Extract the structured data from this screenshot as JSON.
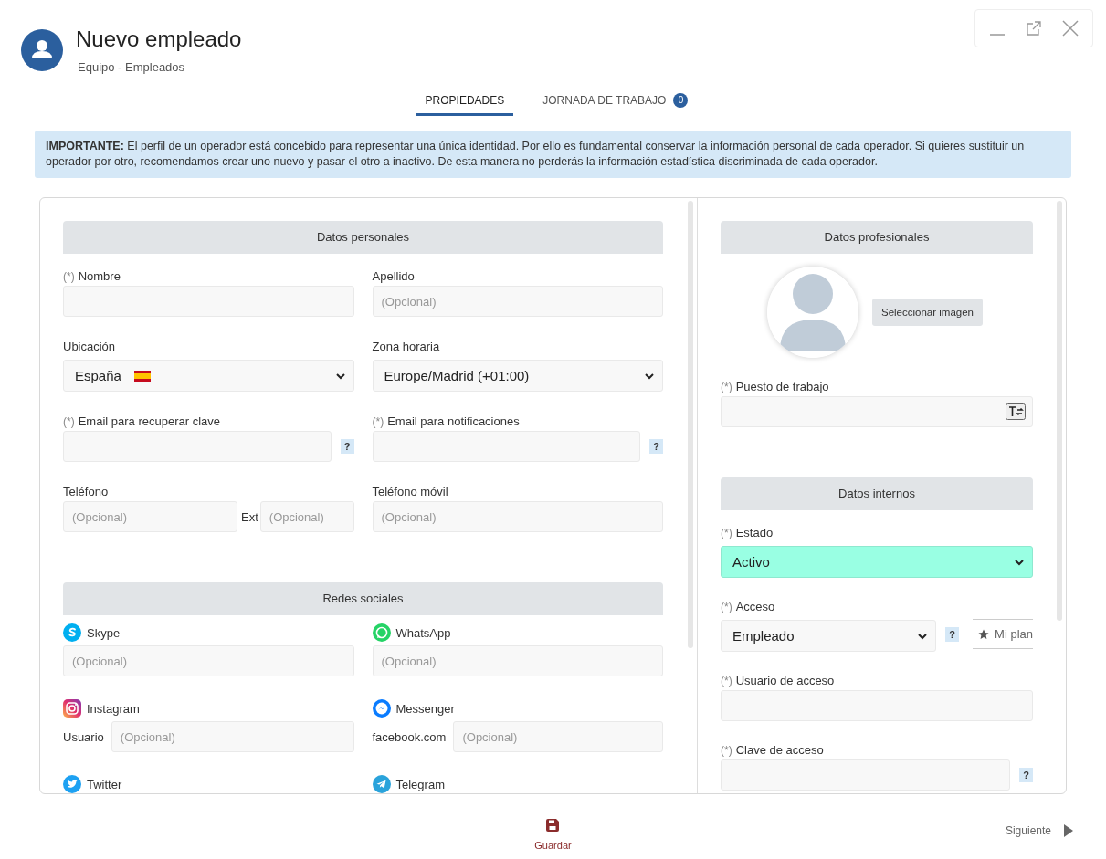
{
  "window": {
    "title": "Nuevo empleado",
    "subtitle": "Equipo - Empleados"
  },
  "tabs": [
    {
      "label": "PROPIEDADES",
      "selected": true
    },
    {
      "label": "JORNADA DE TRABAJO",
      "selected": false,
      "badge": "0"
    }
  ],
  "notice": "**IMPORTANTE:** El perfil de un operador está concebido para representar una única identidad. Por ello es fundamental conservar la información personal de cada operador. Si quieres sustituir un operador por otro, recomendamos crear uno nuevo y pasar el otro a inactivo. De esta manera no perderás la información estadística discriminada de cada operador.",
  "left_sections": [
    {
      "title": "Datos personales",
      "fields": [
        {
          "kind": "text",
          "required_mark": "(*)",
          "label": "Nombre"
        },
        {
          "kind": "text",
          "label": "Apellido",
          "placeholder": "(Opcional)"
        },
        {
          "kind": "country-select",
          "label": "Ubicación",
          "value": "España"
        },
        {
          "kind": "select",
          "label": "Zona horaria",
          "value": "Europe/Madrid (+01:00)"
        },
        {
          "kind": "text",
          "required_mark": "(*)",
          "label": "Email para recuperar clave",
          "help": "?"
        },
        {
          "kind": "text",
          "required_mark": "(*)",
          "label": "Email para notificaciones",
          "help": "?"
        },
        {
          "kind": "phone",
          "label": "Teléfono",
          "placeholder": "(Opcional)",
          "ext_label": "Ext",
          "ext_placeholder": "(Opcional)"
        },
        {
          "kind": "text",
          "label": "Teléfono móvil",
          "placeholder": "(Opcional)"
        }
      ]
    },
    {
      "title": "Redes sociales",
      "fields": [
        {
          "kind": "skype",
          "label": "Skype",
          "placeholder": "(Opcional)"
        },
        {
          "kind": "whatsapp",
          "label": "WhatsApp",
          "placeholder": "(Opcional)"
        },
        {
          "kind": "instagram",
          "label": "Instagram",
          "prefix": "Usuario",
          "placeholder": "(Opcional)"
        },
        {
          "kind": "messenger",
          "label": "Messenger",
          "prefix": "facebook.com",
          "placeholder": "(Opcional)"
        },
        {
          "kind": "twitter",
          "label": "Twitter"
        },
        {
          "kind": "telegram",
          "label": "Telegram"
        }
      ]
    }
  ],
  "right_sections": [
    {
      "title": "Datos profesionales",
      "fields": [
        {
          "kind": "photo",
          "button": "Seleccionar imagen"
        },
        {
          "kind": "text-toggle",
          "required_mark": "(*)",
          "label": "Puesto de trabajo"
        }
      ]
    },
    {
      "title": "Datos internos",
      "fields": [
        {
          "kind": "status-select",
          "required_mark": "(*)",
          "label": "Estado",
          "value": "Activo"
        },
        {
          "kind": "select",
          "required_mark": "(*)",
          "label": "Acceso",
          "value": "Empleado",
          "help": "?",
          "extra_button": "Mi plan"
        },
        {
          "kind": "text",
          "required_mark": "(*)",
          "label": "Usuario de acceso"
        },
        {
          "kind": "text",
          "required_mark": "(*)",
          "label": "Clave de acceso",
          "help": "?"
        }
      ]
    }
  ],
  "footer": {
    "save": "Guardar",
    "next": "Siguiente"
  }
}
